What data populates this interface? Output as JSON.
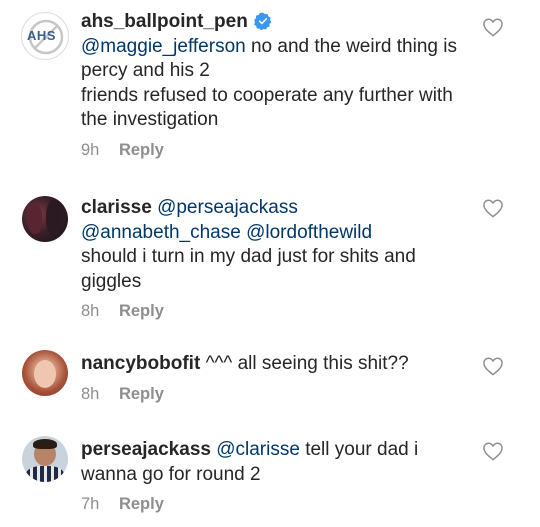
{
  "comments": [
    {
      "username": "ahs_ballpoint_pen",
      "verified": true,
      "avatar_text": "AHS",
      "mention": "@maggie_jefferson",
      "text_1": " no and the weird thing is percy and his 2",
      "text_2": "friends refused to cooperate any further with the investigation",
      "time": "9h",
      "reply_label": "Reply"
    },
    {
      "username": "clarisse",
      "mention_1": "@perseajackass",
      "mention_2": "@annabeth_chase",
      "mention_3": "@lordofthewild",
      "text": "should i turn in my dad just for shits and giggles",
      "time": "8h",
      "reply_label": "Reply"
    },
    {
      "username": "nancybobofit",
      "text": "^^^ all seeing this shit??",
      "time": "8h",
      "reply_label": "Reply"
    },
    {
      "username": "perseajackass",
      "mention": "@clarisse",
      "text": " tell your dad i wanna go for round 2",
      "time": "7h",
      "reply_label": "Reply"
    }
  ],
  "colors": {
    "text": "#262626",
    "mention": "#00376b",
    "meta": "#8e8e8e",
    "verified": "#3897f0"
  }
}
